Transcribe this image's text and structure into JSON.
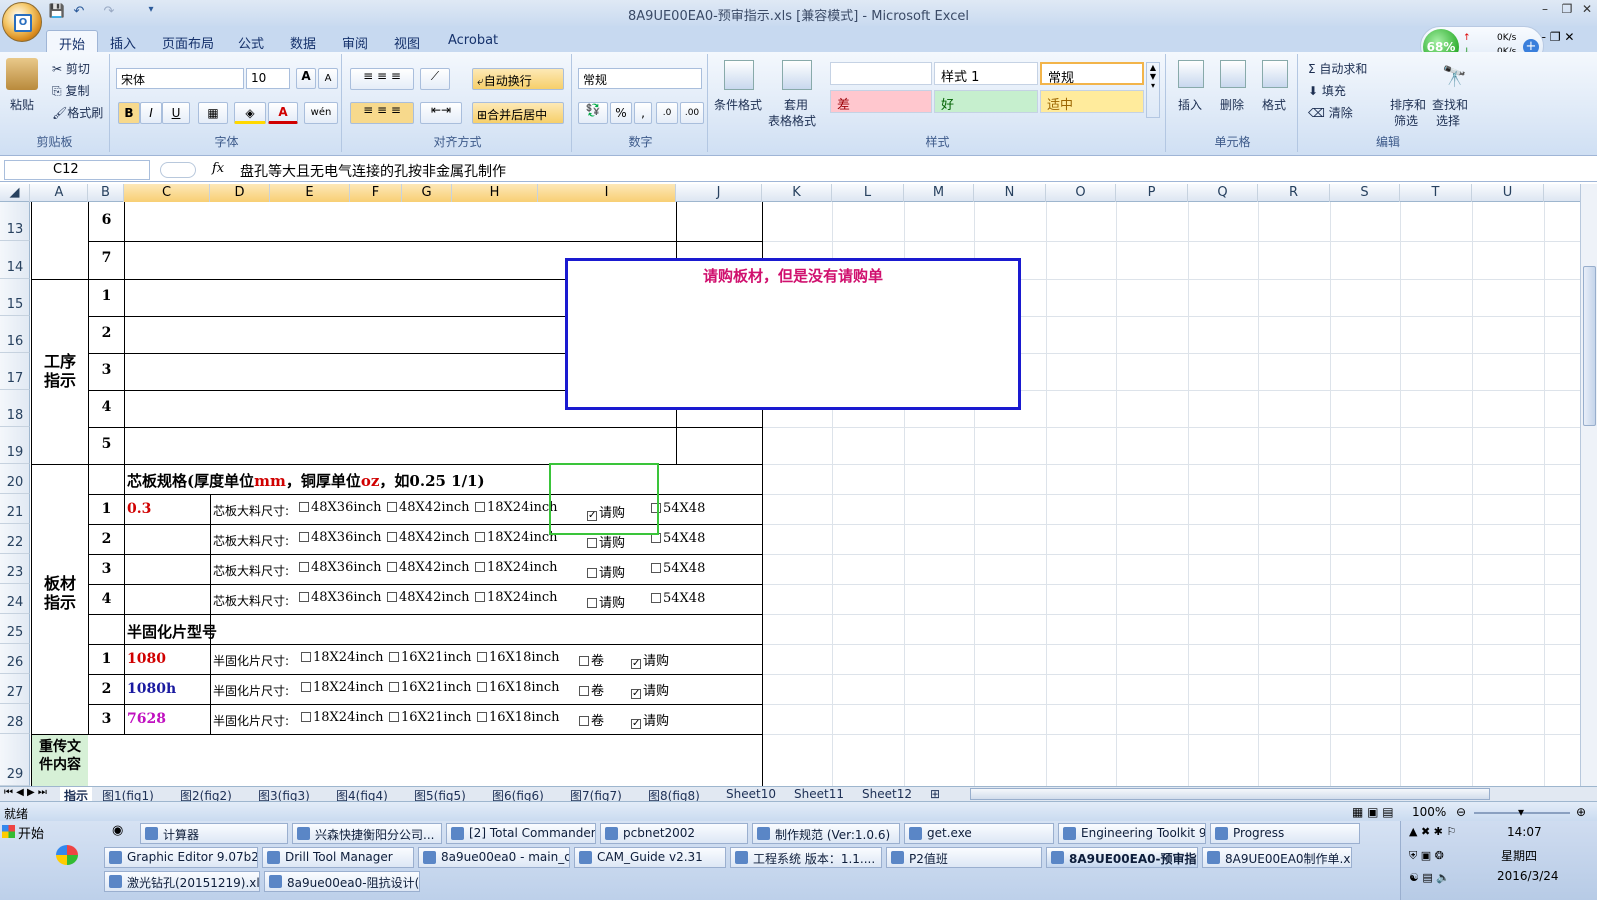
{
  "window": {
    "title": "8A9UE00EA0-预审指示.xls  [兼容模式] - Microsoft Excel",
    "min": "–",
    "restore": "❐",
    "close": "✕"
  },
  "tabs": [
    "开始",
    "插入",
    "页面布局",
    "公式",
    "数据",
    "审阅",
    "视图",
    "Acrobat"
  ],
  "clipboard": {
    "paste": "粘贴",
    "cut": "剪切",
    "copy": "复制",
    "format_painter": "格式刷",
    "label": "剪贴板"
  },
  "font": {
    "name": "宋体",
    "size": "10",
    "label": "字体",
    "bold": "B",
    "italic": "I",
    "underline": "U",
    "grow": "A",
    "shrink": "A",
    "wen": "wén"
  },
  "alignment": {
    "wrap": "自动换行",
    "merge": "合并后居中",
    "label": "对齐方式"
  },
  "number": {
    "format": "常规",
    "percent": "%",
    "comma": ",",
    "label": "数字",
    "inc": ".0",
    "dec": ".00"
  },
  "styles": {
    "cond": "条件格式",
    "table": "套用",
    "table2": "表格格式",
    "s1": "样式 1",
    "normal": "常规",
    "bad": "差",
    "good": "好",
    "neutral": "适中",
    "label": "样式"
  },
  "cells": {
    "insert": "插入",
    "delete": "删除",
    "format": "格式",
    "label": "单元格"
  },
  "editing": {
    "autosum": "自动求和",
    "fill": "填充",
    "clear": "清除",
    "sort": "排序和",
    "sort2": "筛选",
    "find": "查找和",
    "find2": "选择",
    "label": "编辑"
  },
  "network": {
    "percent": "68%",
    "up": "0K/s",
    "down": "0K/s"
  },
  "formula_bar": {
    "cell": "C12",
    "fx": "fx",
    "content": "盘孔等大且无电气连接的孔按非金属孔制作"
  },
  "columns": [
    "A",
    "B",
    "C",
    "D",
    "E",
    "F",
    "G",
    "H",
    "I",
    "J",
    "K",
    "L",
    "M",
    "N",
    "O",
    "P",
    "Q",
    "R",
    "S",
    "T",
    "U"
  ],
  "rows": [
    "13",
    "14",
    "15",
    "16",
    "17",
    "18",
    "19",
    "20",
    "21",
    "22",
    "23",
    "24",
    "25",
    "26",
    "27",
    "28",
    "29"
  ],
  "sheet": {
    "r13": "6",
    "r14": "7",
    "r15": "1",
    "r16": "2",
    "r17": "3",
    "r18": "4",
    "r19": "5",
    "gongxu": "工序\n指示",
    "banca": "板材\n指示",
    "chongchuan": "重传文\n件内容",
    "core_title_a": "芯板规格(厚度单位",
    "core_title_mm": "mm",
    "core_title_b": "，铜厚单位",
    "core_title_oz": "oz",
    "core_title_c": "，如0.25 1/1)",
    "core_rows": [
      {
        "no": "1",
        "val": "0.3",
        "label": "芯板大料尺寸:",
        "o1": "48X36inch",
        "o2": "48X42inch",
        "o3": "18X24inch",
        "req": "请购",
        "o4": "54X48",
        "req_checked": "✓"
      },
      {
        "no": "2",
        "val": "",
        "label": "芯板大料尺寸:",
        "o1": "48X36inch",
        "o2": "48X42inch",
        "o3": "18X24inch",
        "req": "请购",
        "o4": "54X48",
        "req_checked": ""
      },
      {
        "no": "3",
        "val": "",
        "label": "芯板大料尺寸:",
        "o1": "48X36inch",
        "o2": "48X42inch",
        "o3": "18X24inch",
        "req": "请购",
        "o4": "54X48",
        "req_checked": ""
      },
      {
        "no": "4",
        "val": "",
        "label": "芯板大料尺寸:",
        "o1": "48X36inch",
        "o2": "48X42inch",
        "o3": "18X24inch",
        "req": "请购",
        "o4": "54X48",
        "req_checked": ""
      }
    ],
    "pp_title": "半固化片型号",
    "pp_rows": [
      {
        "no": "1",
        "val": "1080",
        "label": "半固化片尺寸:",
        "o1": "18X24inch",
        "o2": "16X21inch",
        "o3": "16X18inch",
        "roll": "卷",
        "req": "请购"
      },
      {
        "no": "2",
        "val": "1080h",
        "label": "半固化片尺寸:",
        "o1": "18X24inch",
        "o2": "16X21inch",
        "o3": "16X18inch",
        "roll": "卷",
        "req": "请购"
      },
      {
        "no": "3",
        "val": "7628",
        "label": "半固化片尺寸:",
        "o1": "18X24inch",
        "o2": "16X21inch",
        "o3": "16X18inch",
        "roll": "卷",
        "req": "请购"
      }
    ],
    "note": "请购板材，但是没有请购单"
  },
  "sheet_tabs": [
    "指示",
    "图1(fig1)",
    "图2(fig2)",
    "图3(fig3)",
    "图4(fig4)",
    "图5(fig5)",
    "图6(fig6)",
    "图7(fig7)",
    "图8(fig8)",
    "Sheet10",
    "Sheet11",
    "Sheet12"
  ],
  "status": {
    "ready": "就绪",
    "zoom": "100%"
  },
  "taskbar": {
    "start": "开始",
    "row1": [
      "计算器",
      "兴森快捷衡阳分公司...",
      "[2] Total Commander 7....",
      "pcbnet2002",
      "制作规范 (Ver:1.0.6)",
      "get.exe",
      "Engineering Toolkit 9.0....",
      "Progress"
    ],
    "row2": [
      "Graphic Editor 9.07b2 (0...",
      "Drill Tool Manager",
      "8a9ue00ea0 - main_qa",
      "CAM_Guide v2.31",
      "工程系统  版本：1.1....",
      "P2值班",
      "8A9UE00EA0-预审指...",
      "8A9UE00EA0制作单.xls..."
    ],
    "row3": [
      "激光钻孔(20151219).xl...",
      "8a9ue00ea0-阻抗设计(..."
    ],
    "time": "14:07",
    "weekday": "星期四",
    "date": "2016/3/24"
  },
  "colors": {
    "accent": "#0b4fa8",
    "note_border": "#1a1ad0",
    "note_text": "#d0106e",
    "green_box": "#3ac43a",
    "red": "#d00000",
    "blue": "#1a1aa0",
    "magenta": "#c010c0"
  }
}
